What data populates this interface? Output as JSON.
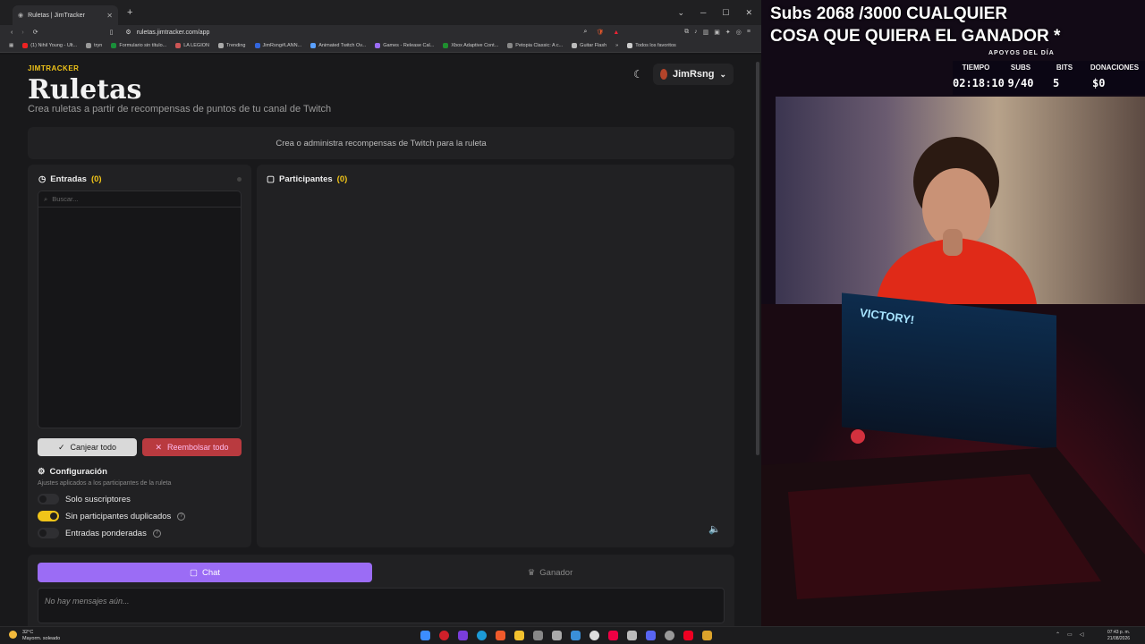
{
  "browser": {
    "tab_title": "Ruletas | JimTracker",
    "url": "ruletas.jimtracker.com/app",
    "bookmarks": [
      "(1) Nihil Young - Ult...",
      "tryn",
      "Formulario sin título...",
      "LA LEGION",
      "Trending",
      "JimRsng#LANN...",
      "Animated Twitch Ov...",
      "Games - Release Cal...",
      "Xbox Adaptive Cont...",
      "Petopia Classic: A c...",
      "Guitar Flash"
    ],
    "all_bookmarks": "Todos los favoritos"
  },
  "app": {
    "brand": "JIMTRACKER",
    "title": "Ruletas",
    "subtitle": "Crea ruletas a partir de recompensas de puntos de tu canal de Twitch",
    "username": "JimRsng",
    "banner": "Crea o administra recompensas de Twitch para la ruleta",
    "entries_label": "Entradas",
    "entries_count": "(0)",
    "search_placeholder": "Buscar...",
    "participants_label": "Participantes",
    "participants_count": "(0)",
    "redeem_all": "Canjear todo",
    "refund_all": "Reembolsar todo",
    "config_title": "Configuración",
    "config_desc": "Ajustes aplicados a los participantes de la ruleta",
    "toggles": [
      {
        "label": "Solo suscriptores",
        "on": false
      },
      {
        "label": "Sin participantes duplicados",
        "on": true
      },
      {
        "label": "Entradas ponderadas",
        "on": false
      }
    ],
    "chat_tab": "Chat",
    "winner_tab": "Ganador",
    "no_messages": "No hay mensajes aún..."
  },
  "stream": {
    "headline_1": "Subs 2068 /3000 CUALQUIER",
    "headline_2": "COSA QUE QUIERA EL GANADOR *",
    "apoyos": "APOYOS DEL DÍA",
    "stats": [
      {
        "label": "TIEMPO",
        "value": "02:18:10"
      },
      {
        "label": "SUBS",
        "value": "9/40"
      },
      {
        "label": "BITS",
        "value": "5"
      },
      {
        "label": "DONACIONES",
        "value": "$0"
      }
    ],
    "game_text": "VICTORY!"
  },
  "taskbar": {
    "temp": "32°C",
    "weather": "Mayorm. soleado",
    "time": "07:43 p. m.",
    "date": "21/08/2026"
  },
  "colors": {
    "accent": "#f0c419",
    "twitch": "#9b6cf5",
    "danger": "#b93a3f"
  }
}
